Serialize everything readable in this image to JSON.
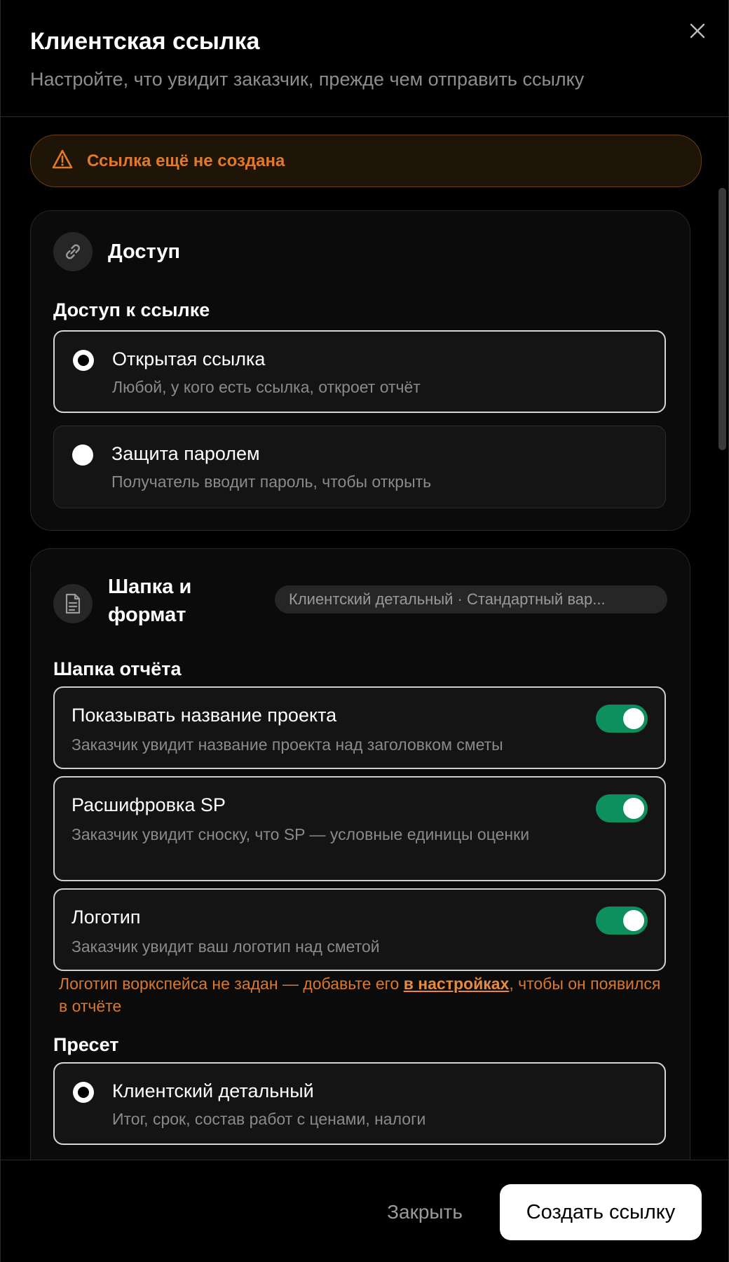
{
  "header": {
    "title": "Клиентская ссылка",
    "subtitle": "Настройте, что увидит заказчик, прежде чем отправить ссылку"
  },
  "warning": {
    "text": "Ссылка ещё не создана",
    "color": "#e07a2a"
  },
  "access": {
    "title": "Доступ",
    "section_label": "Доступ к ссылке",
    "options": [
      {
        "title": "Открытая ссылка",
        "description": "Любой, у кого есть ссылка, откроет отчёт",
        "selected": true
      },
      {
        "title": "Защита паролем",
        "description": "Получатель вводит пароль, чтобы открыть",
        "selected": false
      }
    ]
  },
  "format": {
    "title_line1": "Шапка и",
    "title_line2": "формат",
    "badge": "Клиентский детальный · Стандартный вар...",
    "header_section_label": "Шапка отчёта",
    "toggles": [
      {
        "title": "Показывать название проекта",
        "description": "Заказчик увидит название проекта над заголовком сметы",
        "on": true
      },
      {
        "title": "Расшифровка SP",
        "description": "Заказчик увидит сноску, что SP — условные единицы оценки",
        "on": true
      },
      {
        "title": "Логотип",
        "description": "Заказчик увидит ваш логотип над сметой",
        "on": true
      }
    ],
    "logo_warning": {
      "before": "Логотип воркспейса не задан — добавьте его ",
      "link": "в настройках",
      "after": ", чтобы он появился в отчёте"
    },
    "preset_label": "Пресет",
    "preset_options": [
      {
        "title": "Клиентский детальный",
        "description": "Итог, срок, состав работ с ценами, налоги",
        "selected": true
      }
    ]
  },
  "footer": {
    "close_label": "Закрыть",
    "create_label": "Создать ссылку"
  },
  "colors": {
    "toggle_on": "#0e8f5e",
    "accent_warning": "#e07a2a"
  }
}
